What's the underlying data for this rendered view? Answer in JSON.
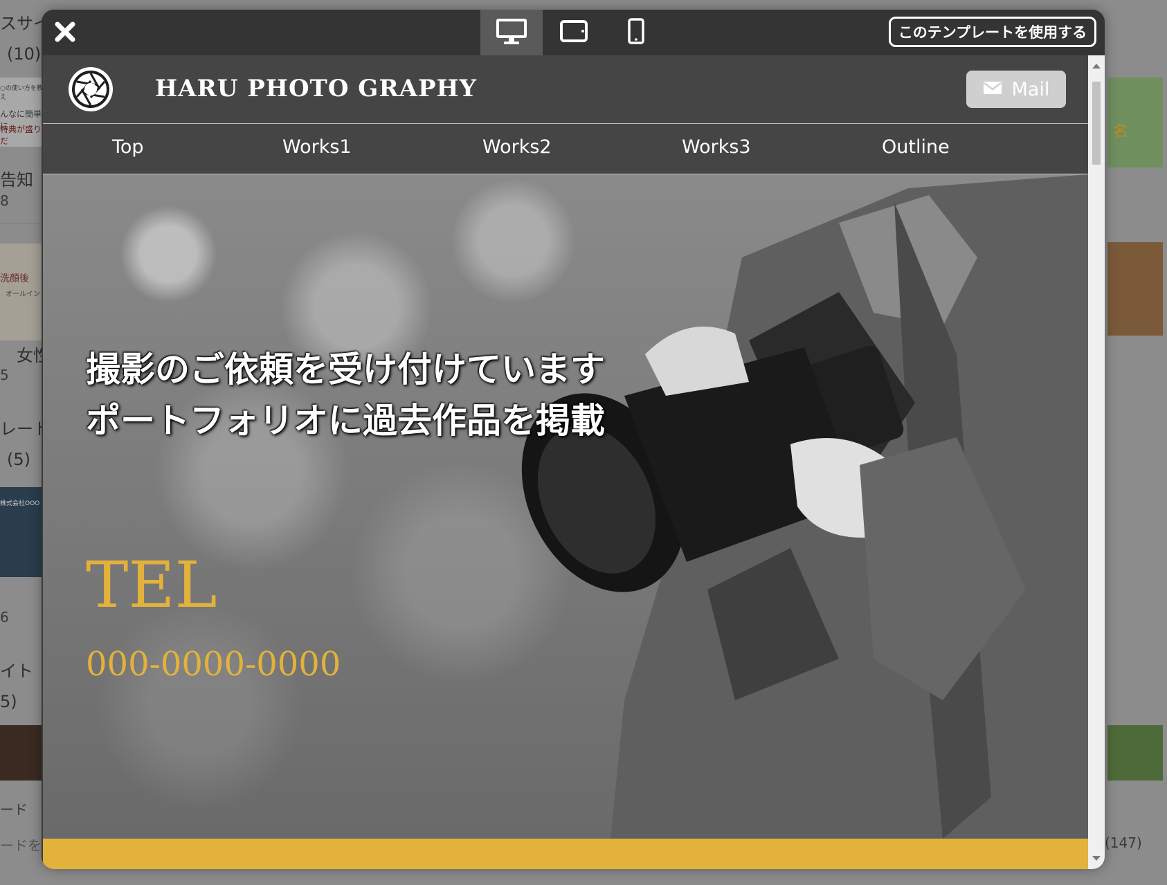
{
  "background_page": {
    "texts": [
      "スサイ",
      "(10)",
      "告知",
      "8",
      "女性",
      "5",
      "レート",
      "(5)",
      "6",
      "イト",
      "5)",
      "ード",
      "ードを",
      "(147)"
    ],
    "thumb_snippets": [
      "○の使い方を教え",
      "んなに簡単に",
      "特典が盛りだ",
      "洗顔後",
      "オールイン",
      "株式会社OOO",
      "名"
    ]
  },
  "modal": {
    "toolbar": {
      "close_icon": "close-x-icon",
      "devices": [
        {
          "name": "desktop",
          "icon": "monitor-icon",
          "active": true
        },
        {
          "name": "tablet",
          "icon": "tablet-icon",
          "active": false
        },
        {
          "name": "mobile",
          "icon": "smartphone-icon",
          "active": false
        }
      ],
      "use_template_label": "このテンプレートを使用する"
    },
    "site": {
      "title": "HARU PHOTO GRAPHY",
      "logo_icon": "camera-aperture-icon",
      "mail_button_label": "Mail",
      "mail_icon": "envelope-icon",
      "nav": [
        "Top",
        "Works1",
        "Works2",
        "Works3",
        "Outline"
      ],
      "hero": {
        "line1": "撮影のご依頼を受け付けています",
        "line2": "ポートフォリオに過去作品を掲載",
        "tel_label": "TEL",
        "tel_number": "000-0000-0000"
      }
    },
    "colors": {
      "accent_gold": "#e2b23b",
      "toolbar_bg": "#343434",
      "header_bg": "#454545"
    }
  }
}
